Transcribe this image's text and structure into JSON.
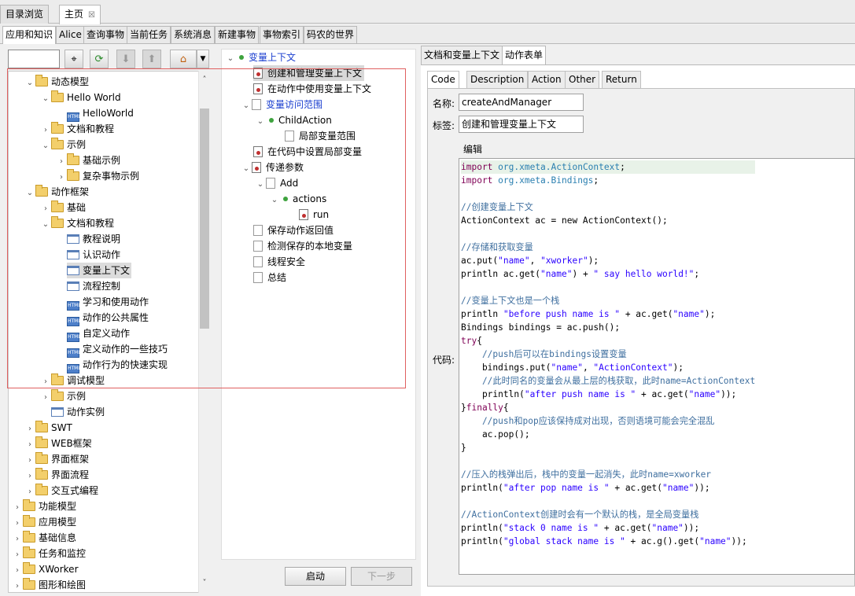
{
  "top_tabs": [
    {
      "label": "目录浏览"
    },
    {
      "label": "主页"
    }
  ],
  "sub_tabs": [
    "应用和知识",
    "Alice",
    "查询事物",
    "当前任务",
    "系统消息",
    "新建事物",
    "事物索引",
    "码农的世界"
  ],
  "left_tree": {
    "search_value": "",
    "items": [
      {
        "label": "动态模型"
      },
      {
        "label": "Hello World"
      },
      {
        "label": "HelloWorld"
      },
      {
        "label": "文档和教程"
      },
      {
        "label": "示例"
      },
      {
        "label": "基础示例"
      },
      {
        "label": "复杂事物示例"
      },
      {
        "label": "动作框架"
      },
      {
        "label": "基础"
      },
      {
        "label": "文档和教程"
      },
      {
        "label": "教程说明"
      },
      {
        "label": "认识动作"
      },
      {
        "label": "变量上下文"
      },
      {
        "label": "流程控制"
      },
      {
        "label": "学习和使用动作"
      },
      {
        "label": "动作的公共属性"
      },
      {
        "label": "自定义动作"
      },
      {
        "label": "定义动作的一些技巧"
      },
      {
        "label": "动作行为的快速实现"
      },
      {
        "label": "调试模型"
      },
      {
        "label": "示例"
      },
      {
        "label": "动作实例"
      },
      {
        "label": "SWT"
      },
      {
        "label": "WEB框架"
      },
      {
        "label": "界面框架"
      },
      {
        "label": "界面流程"
      },
      {
        "label": "交互式编程"
      },
      {
        "label": "功能模型"
      },
      {
        "label": "应用模型"
      },
      {
        "label": "基础信息"
      },
      {
        "label": "任务和监控"
      },
      {
        "label": "XWorker"
      },
      {
        "label": "图形和绘图"
      }
    ]
  },
  "mid_tree": {
    "items": [
      {
        "label": "变量上下文"
      },
      {
        "label": "创建和管理变量上下文"
      },
      {
        "label": "在动作中使用变量上下文"
      },
      {
        "label": "变量访问范围"
      },
      {
        "label": "ChildAction"
      },
      {
        "label": "局部变量范围"
      },
      {
        "label": "在代码中设置局部变量"
      },
      {
        "label": "传递参数"
      },
      {
        "label": "Add"
      },
      {
        "label": "actions"
      },
      {
        "label": "run"
      },
      {
        "label": "保存动作返回值"
      },
      {
        "label": "检测保存的本地变量"
      },
      {
        "label": "线程安全"
      },
      {
        "label": "总结"
      }
    ],
    "start_button": "启动",
    "next_button": "下一步"
  },
  "right": {
    "tabs": [
      "文档和变量上下文",
      "动作表单"
    ],
    "inner_tabs": [
      "Code",
      "Description",
      "Action",
      "Other",
      "Return"
    ],
    "name_label": "名称:",
    "name_value": "createAndManager",
    "tag_label": "标签:",
    "tag_value": "创建和管理变量上下文",
    "edit_label": "编辑",
    "code_label": "代码:",
    "code_lines": [
      "import org.xmeta.ActionContext;",
      "import org.xmeta.Bindings;",
      "",
      "//创建变量上下文",
      "ActionContext ac = new ActionContext();",
      "",
      "//存储和获取变量",
      "ac.put(\"name\", \"xworker\");",
      "println ac.get(\"name\") + \" say hello world!\";",
      "",
      "//变量上下文也是一个栈",
      "println \"before push name is \" + ac.get(\"name\");",
      "Bindings bindings = ac.push();",
      "try{",
      "    //push后可以在bindings设置变量",
      "    bindings.put(\"name\", \"ActionContext\");",
      "    //此时同名的变量会从最上层的栈获取，此时name=ActionContext",
      "    println(\"after push name is \" + ac.get(\"name\"));",
      "}finally{",
      "    //push和pop应该保持成对出现，否则语境可能会完全混乱",
      "    ac.pop();",
      "}",
      "",
      "//压入的栈弹出后，栈中的变量一起消失，此时name=xworker",
      "println(\"after pop name is \" + ac.get(\"name\"));",
      "",
      "//ActionContext创建时会有一个默认的栈，是全局变量栈",
      "println(\"stack 0 name is \" + ac.get(\"name\"));",
      "println(\"global stack name is \" + ac.g().get(\"name\"));"
    ]
  }
}
